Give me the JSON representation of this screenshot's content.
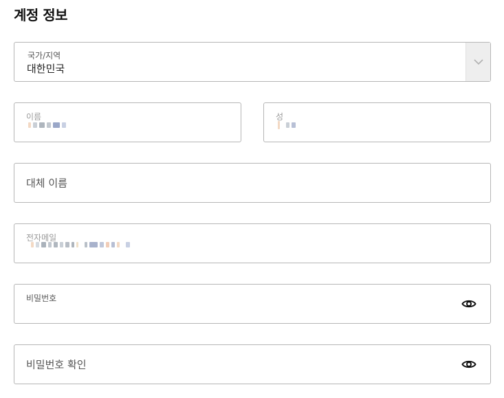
{
  "section": {
    "title": "계정 정보"
  },
  "country": {
    "label": "국가/지역",
    "value": "대한민국"
  },
  "first_name": {
    "label": "이름"
  },
  "last_name": {
    "label": "성"
  },
  "alt_name": {
    "placeholder": "대체 이름"
  },
  "email": {
    "label": "전자메일"
  },
  "password": {
    "label": "비밀번호"
  },
  "password_confirm": {
    "placeholder": "비밀번호 확인"
  },
  "icons": {
    "dropdown": "chevron-down-icon",
    "show_password": "eye-icon"
  }
}
